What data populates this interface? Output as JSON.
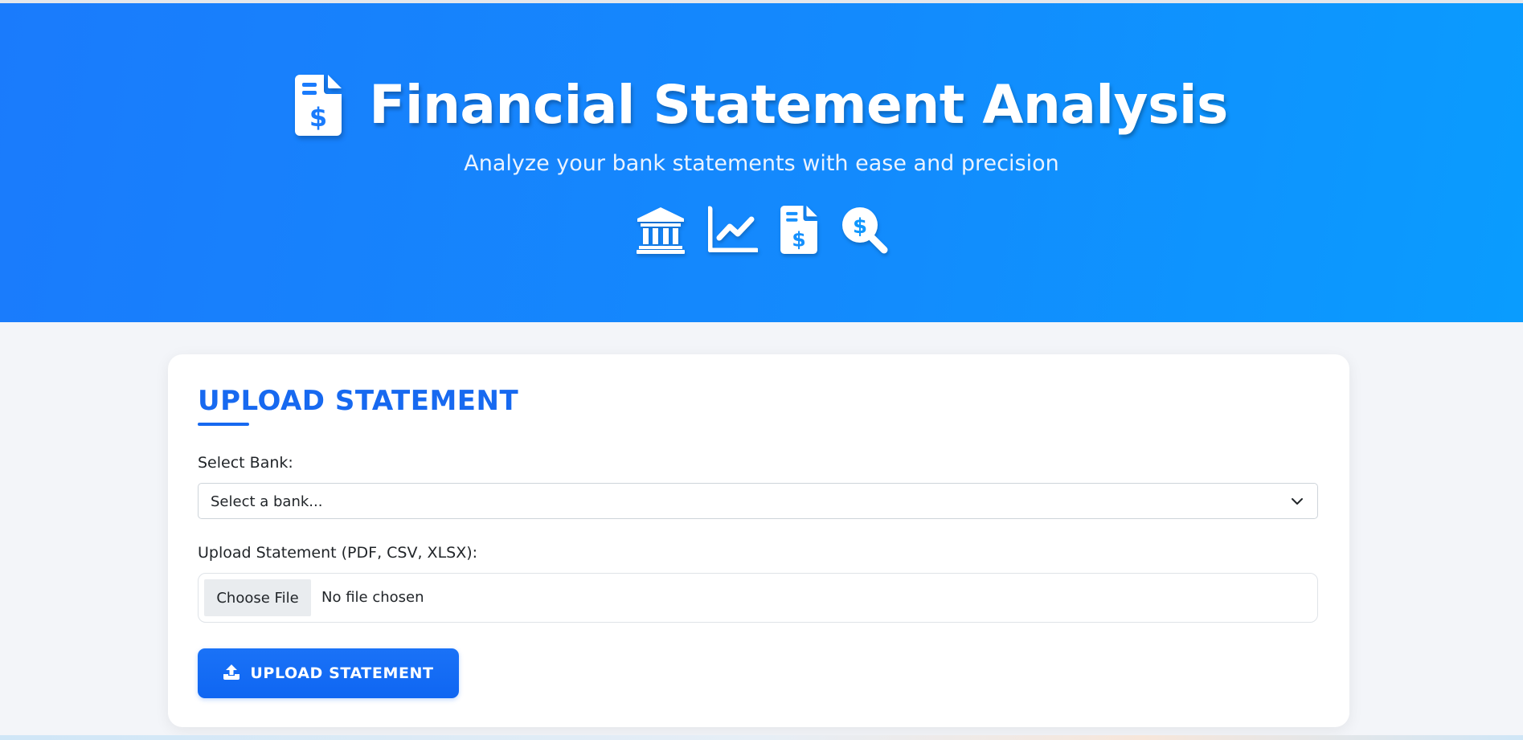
{
  "colors": {
    "hero_gradient_start": "#1a7bfc",
    "hero_gradient_end": "#0a9cfe",
    "accent": "#1769f0",
    "page_background": "#f3f5f9"
  },
  "hero": {
    "title": "Financial Statement Analysis",
    "title_icon": "file-invoice-dollar-icon",
    "subtitle": "Analyze your bank statements with ease and precision",
    "icons": [
      "bank-icon",
      "chart-line-icon",
      "file-invoice-dollar-icon",
      "search-dollar-icon"
    ]
  },
  "upload_card": {
    "heading": "UPLOAD STATEMENT",
    "bank_label": "Select Bank:",
    "bank_select": {
      "selected": "Select a bank..."
    },
    "file_label": "Upload Statement (PDF, CSV, XLSX):",
    "file_input": {
      "button_label": "Choose File",
      "status": "No file chosen"
    },
    "submit_button": {
      "label": "UPLOAD STATEMENT",
      "icon": "upload-icon"
    }
  }
}
